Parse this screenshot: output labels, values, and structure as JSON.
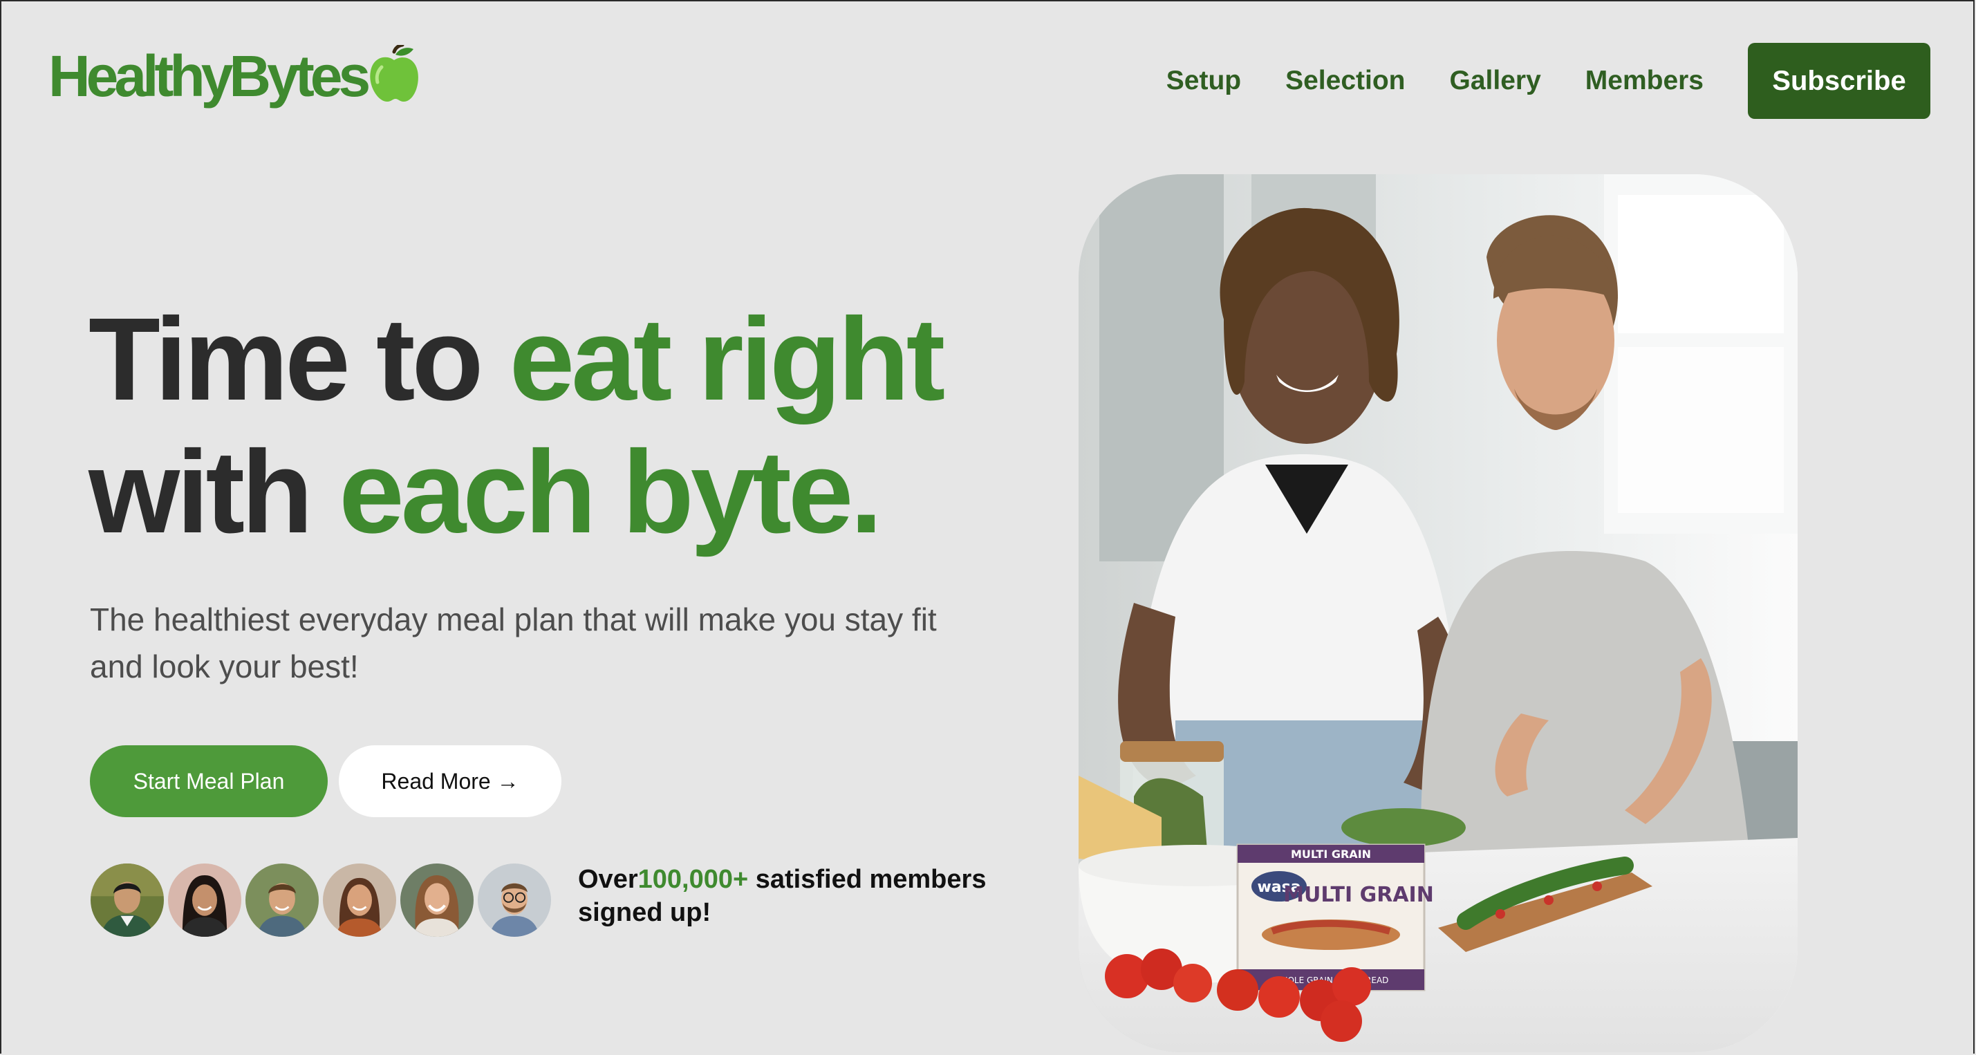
{
  "brand": {
    "name": "HealthyBytes",
    "logo_icon": "green-apple-icon"
  },
  "nav": {
    "items": [
      {
        "label": "Setup"
      },
      {
        "label": "Selection"
      },
      {
        "label": "Gallery"
      },
      {
        "label": "Members"
      }
    ],
    "subscribe_label": "Subscribe"
  },
  "hero": {
    "headline": {
      "line1_dark": "Time to ",
      "line1_green": "eat right",
      "line2_dark": "with ",
      "line2_green": "each byte."
    },
    "subhead": "The healthiest everyday meal plan that will make you stay fit and look your best!",
    "cta_primary": "Start Meal Plan",
    "cta_secondary": "Read More →",
    "members": {
      "prefix": "Over",
      "count": "100,000+",
      "suffix": " satisfied members signed up!"
    }
  },
  "photo": {
    "package_brand": "wasa",
    "package_label": "MULTI GRAIN",
    "package_top": "MULTI GRAIN",
    "package_bottom": "WHOLE GRAIN CRISPBREAD"
  },
  "colors": {
    "brand_green": "#3f8a2f",
    "dark_green": "#2e5e1e",
    "button_green": "#4e9a3a",
    "background": "#e6e6e6"
  }
}
